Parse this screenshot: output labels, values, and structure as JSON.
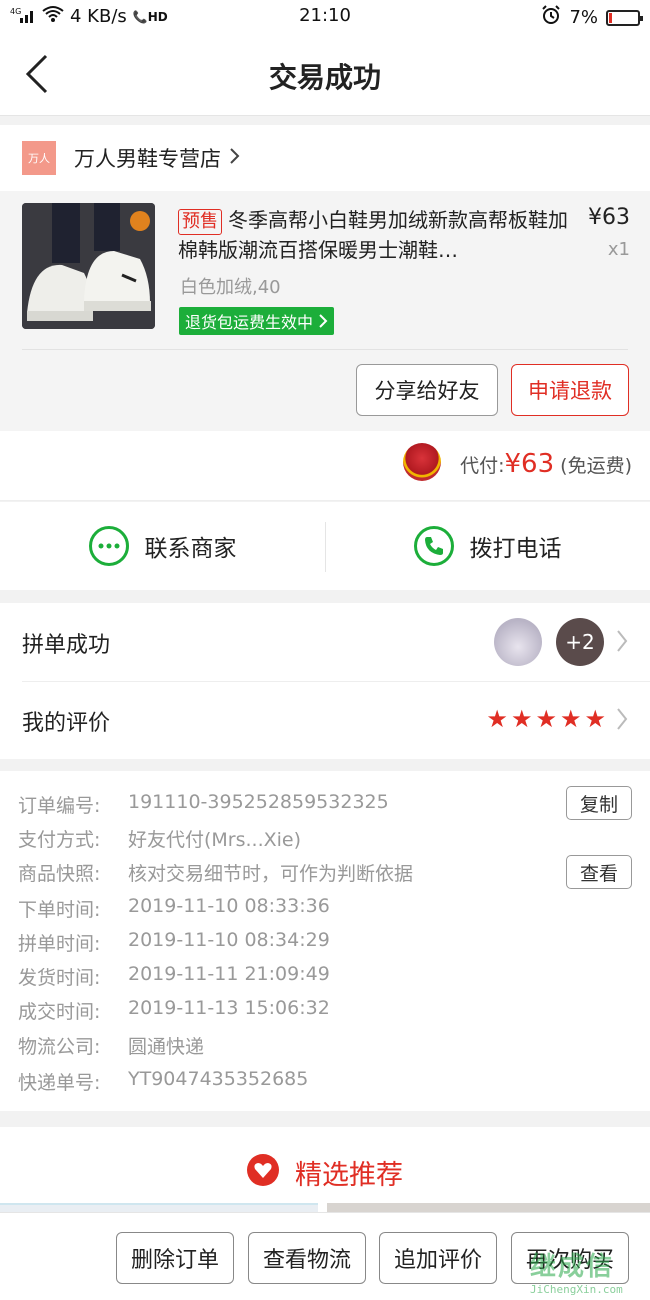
{
  "status_bar": {
    "signal": "4G",
    "net_speed": "4 KB/s",
    "hd": "HD",
    "time": "21:10",
    "battery": "7%"
  },
  "nav": {
    "title": "交易成功"
  },
  "store": {
    "logo_text": "万人",
    "name": "万人男鞋专营店"
  },
  "goods": {
    "tag": "预售",
    "title": "冬季高帮小白鞋男加绒新款高帮板鞋加棉韩版潮流百搭保暖男士潮鞋…",
    "price": "¥63",
    "qty": "x1",
    "spec": "白色加绒,40",
    "guarantee": "退货包运费生效中",
    "share_btn": "分享给好友",
    "refund_btn": "申请退款"
  },
  "payment": {
    "label": "代付:",
    "amount": "¥63",
    "note": "(免运费)"
  },
  "contact": {
    "merchant": "联系商家",
    "call": "拨打电话"
  },
  "group": {
    "label": "拼单成功",
    "extra_count": "+2"
  },
  "review": {
    "label": "我的评价",
    "stars": 5
  },
  "order_info": {
    "rows": [
      {
        "k": "订单编号:",
        "v": "191110-395252859532325"
      },
      {
        "k": "支付方式:",
        "v": "好友代付(Mrs...Xie)"
      },
      {
        "k": "商品快照:",
        "v": "核对交易细节时，可作为判断依据"
      },
      {
        "k": "下单时间:",
        "v": "2019-11-10 08:33:36"
      },
      {
        "k": "拼单时间:",
        "v": "2019-11-10 08:34:29"
      },
      {
        "k": "发货时间:",
        "v": "2019-11-11 21:09:49"
      },
      {
        "k": "成交时间:",
        "v": "2019-11-13 15:06:32"
      },
      {
        "k": "物流公司:",
        "v": "圆通快递"
      },
      {
        "k": "快递单号:",
        "v": "YT9047435352685"
      }
    ],
    "copy_btn": "复制",
    "view_btn": "查看"
  },
  "recommend": {
    "label": "精选推荐"
  },
  "bottom": {
    "delete": "删除订单",
    "logistics": "查看物流",
    "add_review": "追加评价",
    "rebuy": "再次购买"
  },
  "watermark": {
    "brand": "继成信",
    "url": "JiChengXin.com"
  },
  "colors": {
    "accent": "#e02e24",
    "green": "#1cae3a"
  }
}
